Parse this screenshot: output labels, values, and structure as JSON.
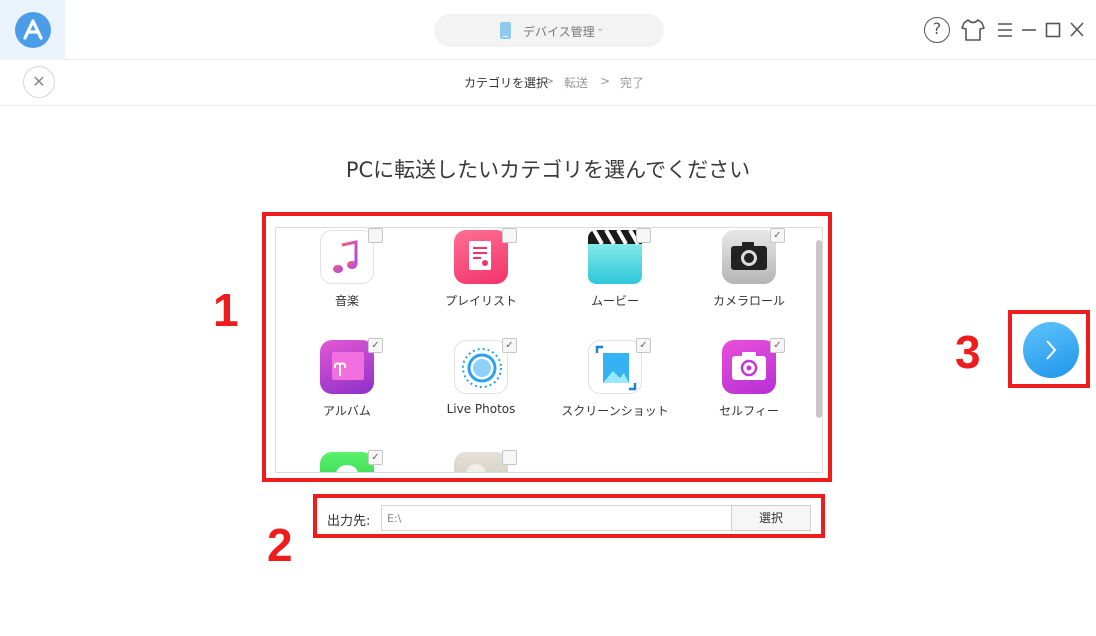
{
  "header": {
    "device_name": "デバイス管理",
    "logo_icon": "anytrans-logo-icon",
    "icons": [
      "help-icon",
      "skin-icon",
      "menu-icon",
      "minimize-icon",
      "maximize-icon",
      "close-icon"
    ]
  },
  "steps": {
    "items": [
      "カテゴリを選択",
      "転送",
      "完了"
    ],
    "separator": ">",
    "active_index": 0
  },
  "main": {
    "heading": "PCに転送したいカテゴリを選んでください",
    "categories": [
      {
        "label": "音楽",
        "icon": "music-note-icon",
        "checked": false
      },
      {
        "label": "プレイリスト",
        "icon": "playlist-icon",
        "checked": false
      },
      {
        "label": "ムービー",
        "icon": "clapperboard-icon",
        "checked": false
      },
      {
        "label": "カメラロール",
        "icon": "camera-icon",
        "checked": true
      },
      {
        "label": "アルバム",
        "icon": "album-icon",
        "checked": true
      },
      {
        "label": "Live Photos",
        "icon": "live-photos-icon",
        "checked": true
      },
      {
        "label": "スクリーンショット",
        "icon": "screenshot-icon",
        "checked": true
      },
      {
        "label": "セルフィー",
        "icon": "selfie-camera-icon",
        "checked": true
      },
      {
        "label": "",
        "icon": "messages-icon",
        "checked": true
      },
      {
        "label": "",
        "icon": "contacts-icon",
        "checked": false
      }
    ]
  },
  "output": {
    "label": "出力先:",
    "path": "E:\\",
    "button": "選択"
  },
  "annotations": {
    "one": "1",
    "two": "2",
    "three": "3"
  },
  "colors": {
    "accent": "#2ea6f1",
    "annotation_red": "#ee1c1c"
  }
}
